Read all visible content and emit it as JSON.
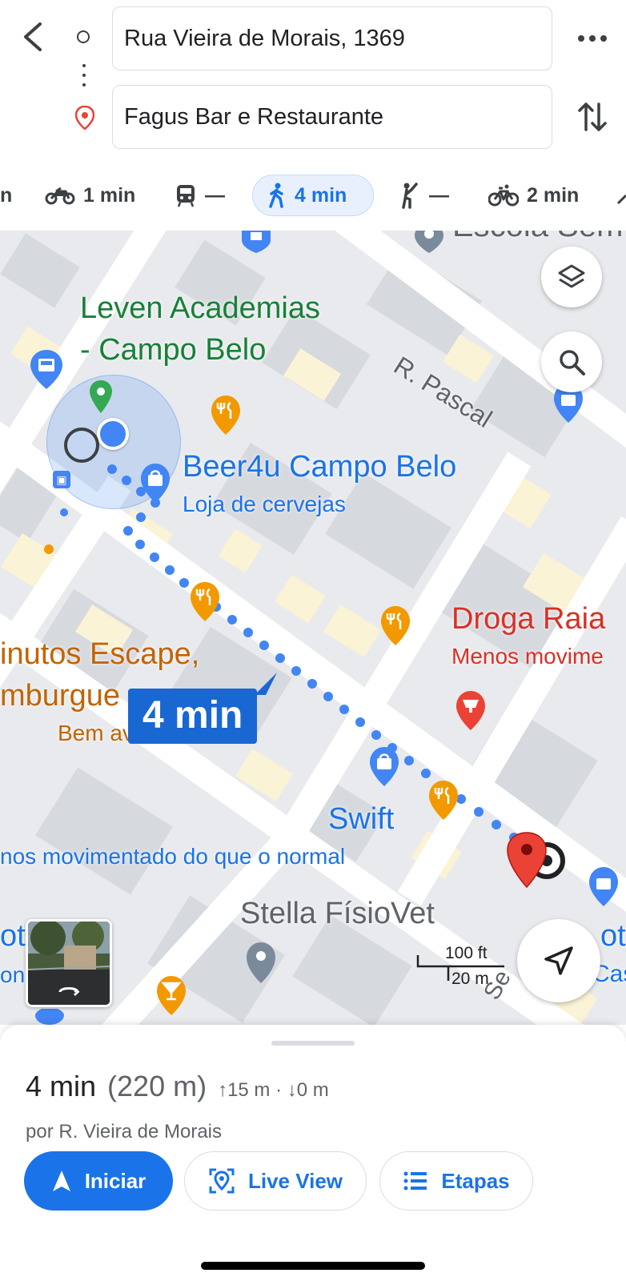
{
  "header": {
    "origin_value": "Rua Vieira de Morais, 1369",
    "destination_value": "Fagus Bar e Restaurante",
    "back_icon": "chevron-left-icon",
    "more_icon": "more-horizontal-icon",
    "swap_icon": "swap-vertical-icon"
  },
  "modes": [
    {
      "icon": "car-icon",
      "label": "n"
    },
    {
      "icon": "motorcycle-icon",
      "label": "1 min"
    },
    {
      "icon": "transit-icon",
      "label": "—"
    },
    {
      "icon": "walk-icon",
      "label": "4 min",
      "active": true
    },
    {
      "icon": "ride-hail-icon",
      "label": "—"
    },
    {
      "icon": "bicycle-icon",
      "label": "2 min"
    }
  ],
  "map": {
    "street_pascal": "R. Pascal",
    "escola": "Escola Sem",
    "leven_1": "Leven Academias",
    "leven_2": "- Campo Belo",
    "beer_name": "Beer4u Campo Belo",
    "beer_sub": "Loja de cervejas",
    "escape_1": "inutos Escape,",
    "escape_2": "mburgue",
    "escape_sub": "Bem avaliados",
    "droga_name": "Droga Raia",
    "droga_sub": "Menos movime",
    "swift_name": "Swift",
    "swift_sub": "nos movimentado do que o normal",
    "stella": "Stella FísioVet",
    "partial_ot1": "ot",
    "partial_ot2": "ot",
    "partial_cas": "Cas",
    "partial_onal": "onal",
    "street_se": "Se",
    "route_badge": "4 min",
    "scale_ft": "100 ft",
    "scale_m": "20 m",
    "accent": "#1a73e8",
    "dest_pin_color": "#ea4335"
  },
  "sheet": {
    "duration": "4 min",
    "distance": "(220 m)",
    "elevation": "↑15 m · ↓0 m",
    "via": "por R. Vieira de Morais",
    "start_label": "Iniciar",
    "liveview_label": "Live View",
    "steps_label": "Etapas"
  }
}
